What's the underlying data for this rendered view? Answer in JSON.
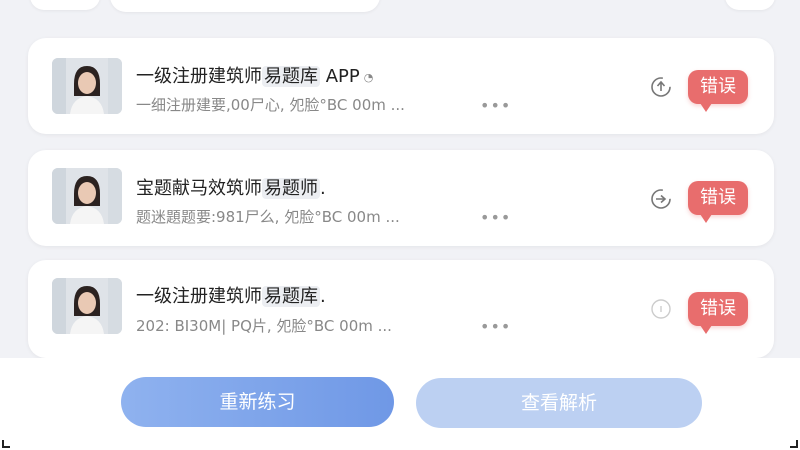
{
  "list": {
    "items": [
      {
        "title_prefix": "一级注册建筑师",
        "title_highlight": "易题库",
        "title_suffix": " APP",
        "subtitle": "一细注册建要,00尸心,  夗脸°BC 00m ...",
        "dots": "•••",
        "error_label": "错误"
      },
      {
        "title_prefix": "宝题献马效筑师",
        "title_highlight": "易题师",
        "title_suffix": ".",
        "subtitle": "题迷題题要:981尸么,  夗脸°BC 00m ...",
        "dots": "•••",
        "error_label": "错误"
      },
      {
        "title_prefix": "一级注册建筑师",
        "title_highlight": "易题库",
        "title_suffix": ".",
        "subtitle": "202: BI30M| PQ片,  夗脸°BC 00m ...",
        "dots": "•••",
        "error_label": "错误"
      }
    ]
  },
  "actions": {
    "retry_label": "重新练习",
    "analysis_label": "查看解析"
  },
  "colors": {
    "error": "#e86d6d",
    "primary": "#6f98e6",
    "primary_light": "#bcd0f2"
  }
}
